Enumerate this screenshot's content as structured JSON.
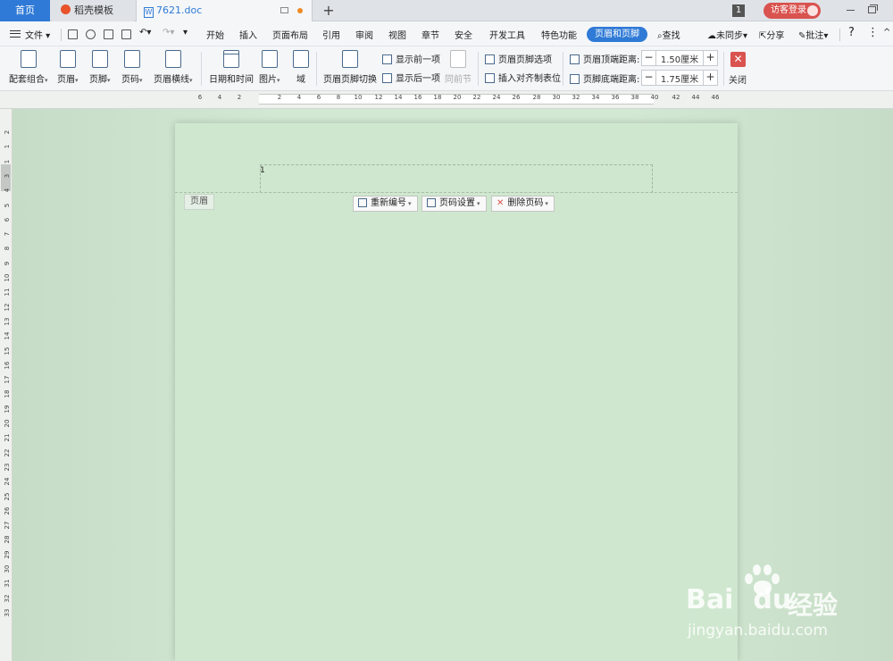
{
  "tabs": {
    "home": "首页",
    "template": "稻壳模板",
    "document": "7621.doc",
    "new_tab": "+"
  },
  "titlebar": {
    "badge": "1",
    "login": "访客登录"
  },
  "menubar": {
    "file": "文件",
    "items": [
      "开始",
      "插入",
      "页面布局",
      "引用",
      "审阅",
      "视图",
      "章节",
      "安全",
      "开发工具",
      "特色功能"
    ],
    "active": "页眉和页脚",
    "search": "查找",
    "sync": "未同步",
    "share": "分享",
    "comment": "批注"
  },
  "ribbon": {
    "combo": "配套组合",
    "header": "页眉",
    "footer": "页脚",
    "page_number": "页码",
    "header_line": "页眉横线",
    "datetime": "日期和时间",
    "picture": "图片",
    "field": "域",
    "switch": "页眉页脚切换",
    "show_prev": "显示前一项",
    "show_next": "显示后一项",
    "same_as_prev": "同前节",
    "hf_options": "页眉页脚选项",
    "align_tab": "插入对齐制表位",
    "header_dist_label": "页眉顶端距离:",
    "header_dist_value": "1.50厘米",
    "footer_dist_label": "页脚底端距离:",
    "footer_dist_value": "1.75厘米",
    "close": "关闭"
  },
  "ruler": {
    "h_ticks": [
      "6",
      "4",
      "2",
      "2",
      "4",
      "6",
      "8",
      "10",
      "12",
      "14",
      "16",
      "18",
      "20",
      "22",
      "24",
      "26",
      "28",
      "30",
      "32",
      "34",
      "36",
      "38",
      "40",
      "42",
      "44",
      "46"
    ],
    "v_ticks": [
      "2",
      "1",
      "1",
      "3",
      "4",
      "5",
      "6",
      "7",
      "8",
      "9",
      "10",
      "11",
      "12",
      "13",
      "14",
      "15",
      "16",
      "17",
      "18",
      "19",
      "20",
      "21",
      "22",
      "23",
      "24",
      "25",
      "26",
      "27",
      "28",
      "29",
      "30",
      "31",
      "32",
      "33"
    ]
  },
  "page": {
    "header_page_number": "1",
    "header_tag": "页眉",
    "renumber": "重新编号",
    "page_num_settings": "页码设置",
    "delete_page_num": "删除页码"
  },
  "watermark": {
    "brand": "Bai",
    "brand_du": "du",
    "text": "经验",
    "url": "jingyan.baidu.com"
  }
}
